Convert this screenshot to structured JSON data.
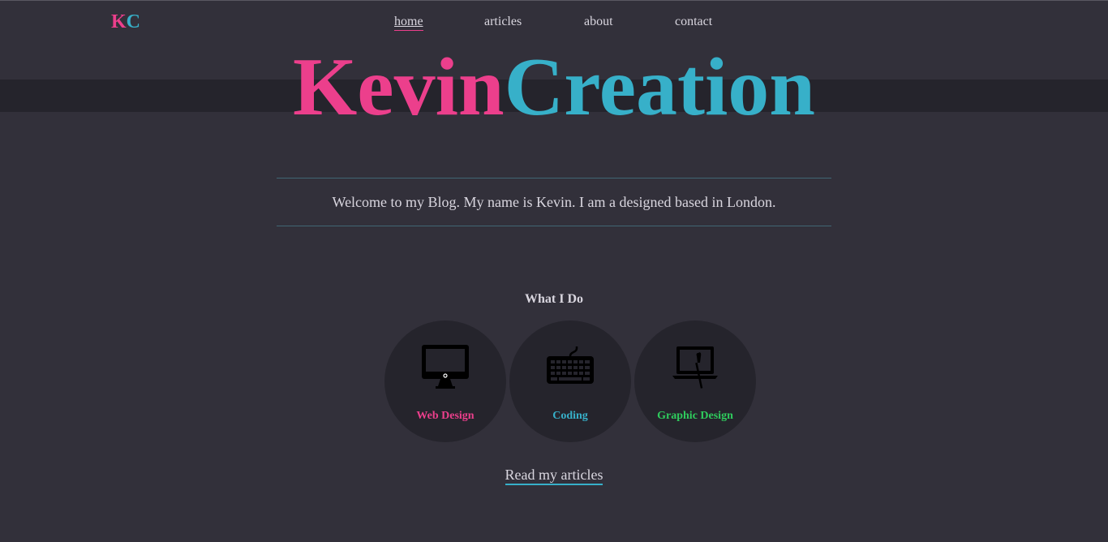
{
  "logo": {
    "part1": "K",
    "part2": "C"
  },
  "nav": {
    "home": "home",
    "articles": "articles",
    "about": "about",
    "contact": "contact"
  },
  "hero": {
    "title_part1": "Kevin",
    "title_part2": "Creation"
  },
  "intro": {
    "text": "Welcome to my Blog. My name is Kevin. I am a designed based in London."
  },
  "services": {
    "title": "What I Do",
    "items": [
      {
        "label": "Web Design",
        "icon": "monitor-icon",
        "color": "#ec3f8c"
      },
      {
        "label": "Coding",
        "icon": "keyboard-icon",
        "color": "#37b0c9"
      },
      {
        "label": "Graphic Design",
        "icon": "laptop-brush-icon",
        "color": "#2fcc5d"
      }
    ]
  },
  "cta": {
    "label": "Read my articles"
  },
  "colors": {
    "background": "#32303a",
    "band": "#25242c",
    "accent_pink": "#ec3f8c",
    "accent_teal": "#37b0c9",
    "accent_green": "#2fcc5d"
  }
}
